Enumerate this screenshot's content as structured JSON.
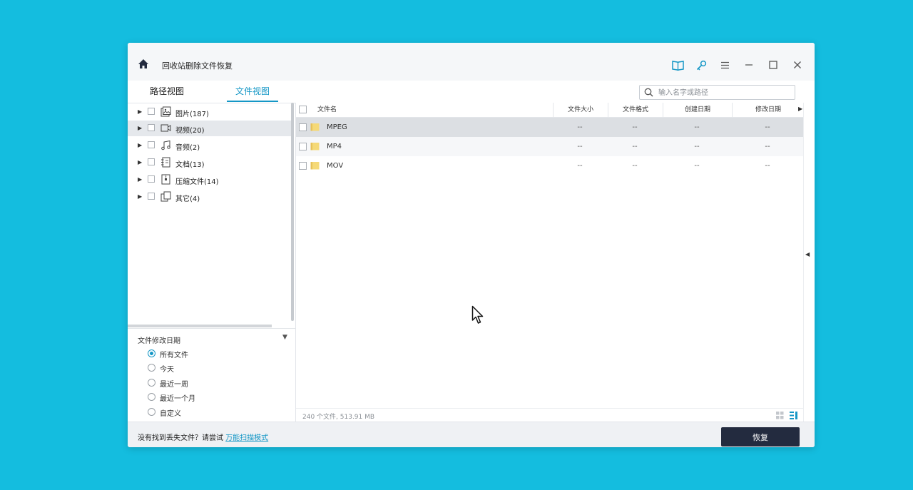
{
  "window": {
    "title": "回收站删除文件恢复"
  },
  "tabs": [
    {
      "label": "路径视图",
      "active": false
    },
    {
      "label": "文件视图",
      "active": true
    }
  ],
  "search": {
    "placeholder": "输入名字或路径"
  },
  "tree": {
    "items": [
      {
        "label": "图片(187)",
        "icon": "image-icon",
        "selected": false
      },
      {
        "label": "视频(20)",
        "icon": "video-icon",
        "selected": true
      },
      {
        "label": "音频(2)",
        "icon": "music-icon",
        "selected": false
      },
      {
        "label": "文档(13)",
        "icon": "document-icon",
        "selected": false
      },
      {
        "label": "压缩文件(14)",
        "icon": "archive-icon",
        "selected": false
      },
      {
        "label": "其它(4)",
        "icon": "other-files-icon",
        "selected": false
      }
    ]
  },
  "filter": {
    "title": "文件修改日期",
    "options": [
      {
        "label": "所有文件",
        "checked": true
      },
      {
        "label": "今天",
        "checked": false
      },
      {
        "label": "最近一周",
        "checked": false
      },
      {
        "label": "最近一个月",
        "checked": false
      },
      {
        "label": "自定义",
        "checked": false
      }
    ]
  },
  "list": {
    "columns": [
      "文件名",
      "文件大小",
      "文件格式",
      "创建日期",
      "修改日期"
    ],
    "rows": [
      {
        "name": "MPEG",
        "size": "--",
        "format": "--",
        "created": "--",
        "modified": "--"
      },
      {
        "name": "MP4",
        "size": "--",
        "format": "--",
        "created": "--",
        "modified": "--"
      },
      {
        "name": "MOV",
        "size": "--",
        "format": "--",
        "created": "--",
        "modified": "--"
      }
    ]
  },
  "status": {
    "summary": "240 个文件, 513.91 MB"
  },
  "footer": {
    "prompt": "没有找到丢失文件？请尝试 ",
    "link": "万能扫描模式",
    "recover_label": "恢复"
  },
  "colors": {
    "background": "#14bddf",
    "accent": "#1597c6",
    "button": "#232b3f"
  }
}
